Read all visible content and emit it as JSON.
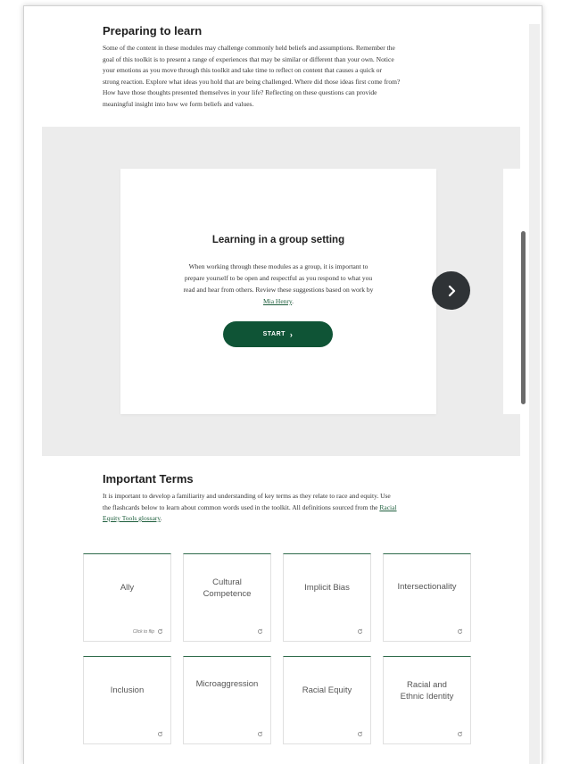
{
  "preparing": {
    "heading": "Preparing to learn",
    "body_lines": [
      "Some of the content in these modules may challenge commonly held beliefs and assumptions. Remember the",
      "goal of this toolkit is to present a range of experiences that may be similar or different than your own. Notice",
      "your emotions as you move through this toolkit and take time to reflect on content that causes a quick or",
      "strong reaction. Explore what ideas you hold that are being challenged. Where did those ideas first come from?",
      "How have those thoughts presented themselves in your life? Reflecting on these questions can provide",
      "meaningful insight into how we form beliefs and values."
    ]
  },
  "carousel": {
    "card_title": "Learning in a group setting",
    "card_text_lines": [
      "When working through these modules as a group, it is important to",
      "prepare yourself to be open and respectful as you respond to what you",
      "read and hear from others. Review these suggestions based on work by"
    ],
    "card_link": "Mia Henry",
    "card_link_suffix": ".",
    "start_label": "START",
    "colors": {
      "button": "#0f5436",
      "next": "#2f3336",
      "background": "#ececec"
    }
  },
  "terms": {
    "heading": "Important Terms",
    "body_lines": [
      "It is important to develop a familiarity and understanding of key terms as they relate to race and equity. Use",
      "the flashcards below to learn about common words used in the toolkit. All definitions sourced from the"
    ],
    "link_line1": "Racial",
    "link_line2": "Equity Tools glossary",
    "link_suffix": ".",
    "flip_hint": "Click to flip",
    "cards": [
      "Ally",
      "Cultural Competence",
      "Implicit Bias",
      "Intersectionality",
      "Inclusion",
      "Microaggression",
      "Racial Equity",
      "Racial and Ethnic Identity"
    ]
  }
}
